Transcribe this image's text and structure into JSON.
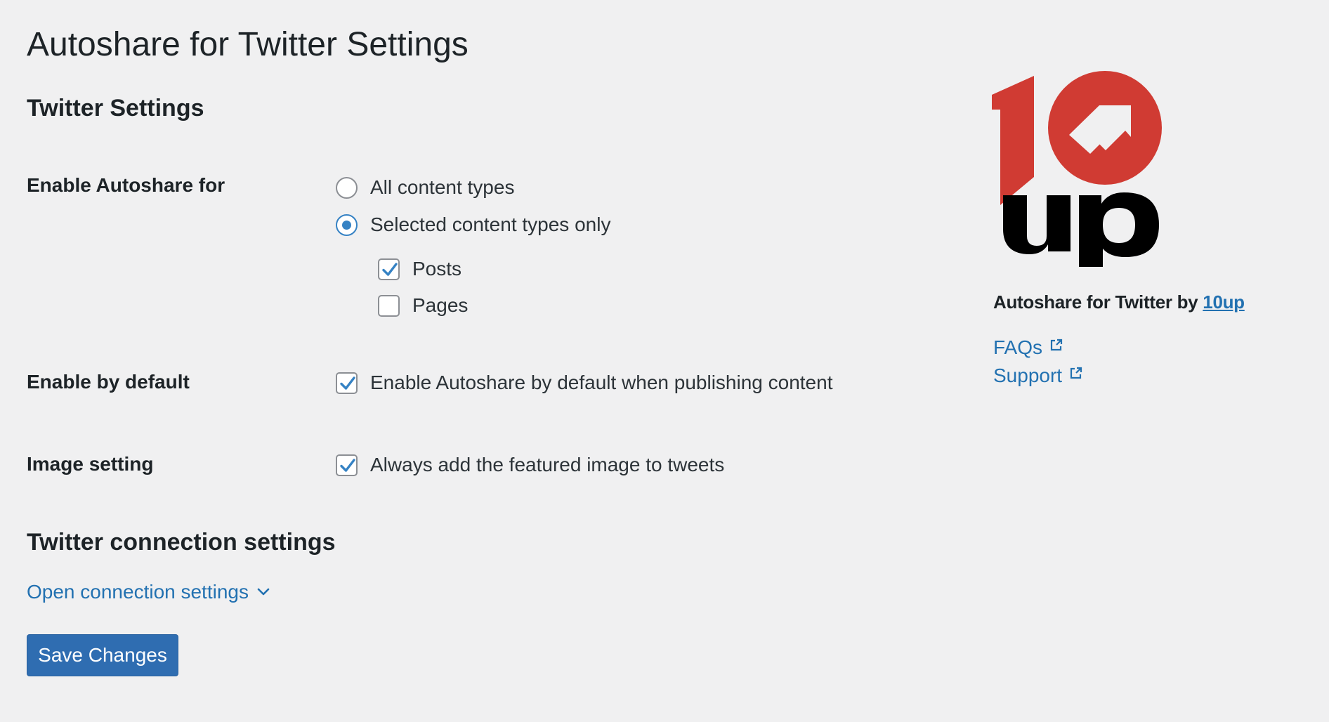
{
  "page": {
    "title": "Autoshare for Twitter Settings"
  },
  "twitter_settings": {
    "heading": "Twitter Settings",
    "enable_autoshare": {
      "label": "Enable Autoshare for",
      "options": [
        {
          "label": "All content types",
          "checked": false
        },
        {
          "label": "Selected content types only",
          "checked": true
        }
      ],
      "content_types": [
        {
          "label": "Posts",
          "checked": true
        },
        {
          "label": "Pages",
          "checked": false
        }
      ]
    },
    "enable_by_default": {
      "label": "Enable by default",
      "checkbox_label": "Enable Autoshare by default when publishing content",
      "checked": true
    },
    "image_setting": {
      "label": "Image setting",
      "checkbox_label": "Always add the featured image to tweets",
      "checked": true
    }
  },
  "connection_settings": {
    "heading": "Twitter connection settings",
    "toggle_label": "Open connection settings"
  },
  "save_button": {
    "label": "Save Changes"
  },
  "sidebar": {
    "logo_text": "10up",
    "byline_prefix": "Autoshare for Twitter by",
    "byline_link": "10up",
    "links": [
      {
        "label": "FAQs",
        "icon": "external-link-icon"
      },
      {
        "label": "Support",
        "icon": "external-link-icon"
      }
    ]
  },
  "colors": {
    "background": "#f0f0f1",
    "accent": "#2271b1",
    "button": "#2f6db1",
    "logo_red": "#d03b33",
    "logo_black": "#000000"
  }
}
